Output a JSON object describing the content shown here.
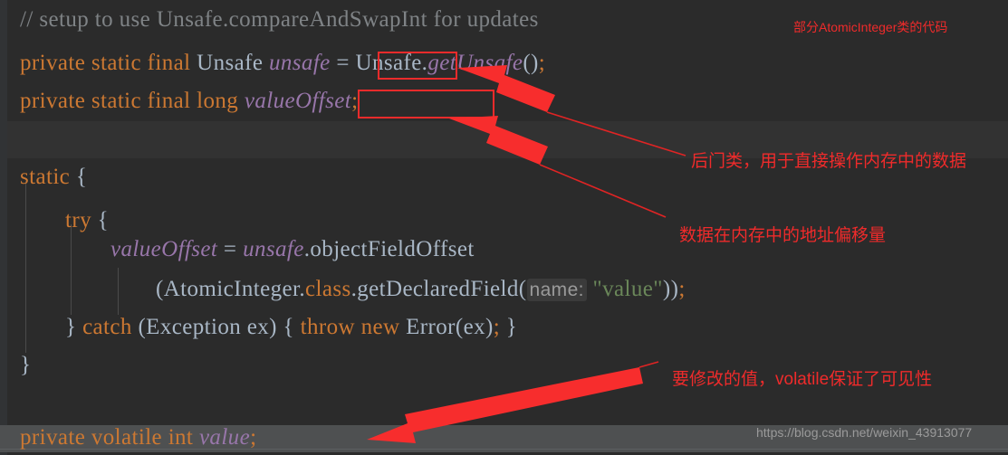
{
  "theme": {
    "editor_bg": "#2b2b2b",
    "band_bg": "#323232",
    "gutter_bg": "#313335",
    "highlight_row_bg": "#4e5051",
    "annotation_red": "#ef2b2b",
    "box_red": "#ee2b2b",
    "comment": "#7f8386",
    "keyword": "#cc7832",
    "identifier": "#a9b7c6",
    "field": "#9876aa",
    "string": "#6a8759",
    "param_hint": "#9a9a9a"
  },
  "code": {
    "language": "java",
    "lines": [
      {
        "n": 1,
        "indent": 0,
        "text": "// setup to use Unsafe.compareAndSwapInt for updates",
        "tokens": [
          {
            "t": "// setup to use Unsafe.compareAndSwapInt for updates",
            "c": "cmt"
          }
        ]
      },
      {
        "n": 2,
        "indent": 0,
        "text": "private static final Unsafe unsafe = Unsafe.getUnsafe();",
        "tokens": [
          {
            "t": "private ",
            "c": "kw"
          },
          {
            "t": "static ",
            "c": "kw"
          },
          {
            "t": "final ",
            "c": "kw"
          },
          {
            "t": "Unsafe ",
            "c": "cls"
          },
          {
            "t": "unsafe",
            "c": "fld"
          },
          {
            "t": " = ",
            "c": "id"
          },
          {
            "t": "Unsafe.",
            "c": "cls"
          },
          {
            "t": "getUnsafe",
            "c": "fld"
          },
          {
            "t": "()",
            "c": "id"
          },
          {
            "t": ";",
            "c": "pct"
          }
        ]
      },
      {
        "n": 3,
        "indent": 0,
        "text": "private static final long valueOffset;",
        "tokens": [
          {
            "t": "private ",
            "c": "kw"
          },
          {
            "t": "static ",
            "c": "kw"
          },
          {
            "t": "final ",
            "c": "kw"
          },
          {
            "t": "long ",
            "c": "kw"
          },
          {
            "t": "valueOffset",
            "c": "fld"
          },
          {
            "t": ";",
            "c": "pct"
          }
        ]
      },
      {
        "n": 4,
        "indent": 0,
        "text": "static {",
        "tokens": [
          {
            "t": "static ",
            "c": "kw"
          },
          {
            "t": "{",
            "c": "id"
          }
        ]
      },
      {
        "n": 5,
        "indent": 1,
        "text": "try {",
        "tokens": [
          {
            "t": "try ",
            "c": "kw"
          },
          {
            "t": "{",
            "c": "id"
          }
        ]
      },
      {
        "n": 6,
        "indent": 2,
        "text": "valueOffset = unsafe.objectFieldOffset",
        "tokens": [
          {
            "t": "valueOffset",
            "c": "fld"
          },
          {
            "t": " = ",
            "c": "id"
          },
          {
            "t": "unsafe",
            "c": "fld"
          },
          {
            "t": ".objectFieldOffset",
            "c": "id"
          }
        ]
      },
      {
        "n": 7,
        "indent": 3,
        "text": "(AtomicInteger.class.getDeclaredField( name: \"value\"));",
        "tokens": [
          {
            "t": "(AtomicInteger.",
            "c": "id"
          },
          {
            "t": "class",
            "c": "kw"
          },
          {
            "t": ".getDeclaredField(",
            "c": "id"
          },
          {
            "t": "name:",
            "c": "hint"
          },
          {
            "t": " ",
            "c": "id"
          },
          {
            "t": "\"value\"",
            "c": "str"
          },
          {
            "t": "))",
            "c": "id"
          },
          {
            "t": ";",
            "c": "pct"
          }
        ]
      },
      {
        "n": 8,
        "indent": 1,
        "text": "} catch (Exception ex) { throw new Error(ex); }",
        "tokens": [
          {
            "t": "} ",
            "c": "id"
          },
          {
            "t": "catch ",
            "c": "kw"
          },
          {
            "t": "(Exception ex) { ",
            "c": "id"
          },
          {
            "t": "throw ",
            "c": "kw"
          },
          {
            "t": "new ",
            "c": "kw"
          },
          {
            "t": "Error(ex)",
            "c": "id"
          },
          {
            "t": "; ",
            "c": "pct"
          },
          {
            "t": "}",
            "c": "id"
          }
        ]
      },
      {
        "n": 9,
        "indent": 0,
        "text": "}",
        "tokens": [
          {
            "t": "}",
            "c": "id"
          }
        ]
      },
      {
        "n": 10,
        "indent": 0,
        "text": "private volatile int value;",
        "tokens": [
          {
            "t": "private ",
            "c": "kw"
          },
          {
            "t": "volatile ",
            "c": "kw"
          },
          {
            "t": "int ",
            "c": "kw"
          },
          {
            "t": "value",
            "c": "fld"
          },
          {
            "t": ";",
            "c": "pct"
          }
        ]
      }
    ]
  },
  "highlights": {
    "boxes": [
      {
        "label": "unsafe-field-box",
        "target": "unsafe"
      },
      {
        "label": "valueoffset-field-box",
        "target": "valueOffset"
      }
    ]
  },
  "annotations": [
    {
      "id": "title-note",
      "text": "部分AtomicInteger类的代码",
      "size": "small"
    },
    {
      "id": "unsafe-note",
      "text": "后门类，用于直接操作内存中的数据",
      "size": "big"
    },
    {
      "id": "valueoffset-note",
      "text": "数据在内存中的地址偏移量",
      "size": "big"
    },
    {
      "id": "value-note",
      "text": "要修改的值，volatile保证了可见性",
      "size": "big"
    }
  ],
  "watermark": {
    "text": "https://blog.csdn.net/weixin_43913077"
  }
}
